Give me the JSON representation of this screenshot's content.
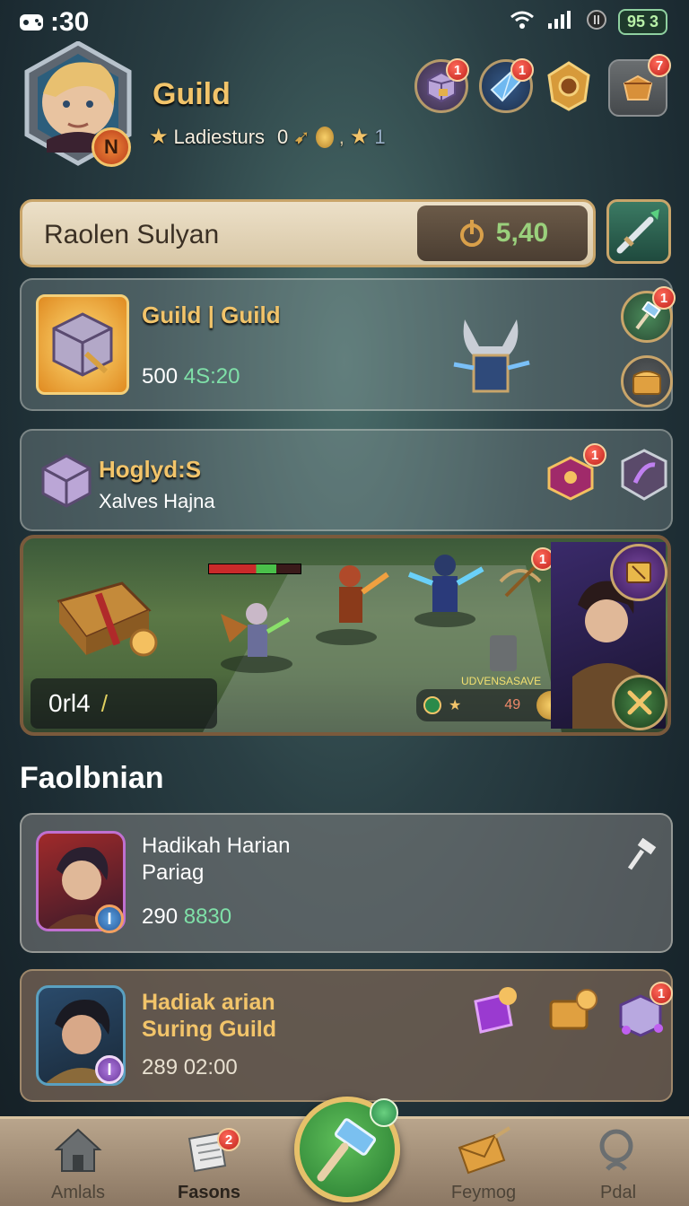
{
  "status": {
    "time": ":30",
    "battery": "95 3"
  },
  "header": {
    "title": "Guild",
    "subtitle": "Ladiesturs",
    "subtitle_value": "0",
    "subtitle_extra": "1",
    "top_icons": [
      {
        "icon": "cube-chest-icon",
        "badge": "1"
      },
      {
        "icon": "crystal-icon",
        "badge": "1"
      },
      {
        "icon": "amulet-icon",
        "badge": ""
      },
      {
        "icon": "gift-box-icon",
        "badge": "7"
      }
    ],
    "avatar_badge": "N"
  },
  "namebar": {
    "label": "Raolen Sulyan",
    "value": "5,40"
  },
  "cards": {
    "card1": {
      "title": "Guild | Guild",
      "num": "500",
      "num_green": "4S:20",
      "badge": "1"
    },
    "card2": {
      "title": "Hoglyd:S",
      "subtitle": "Xalves Hajna",
      "badge": "1"
    },
    "card3": {
      "counter": "0rl4",
      "counter_suffix": "/",
      "hud_label": "UDVENSASAVE",
      "hud_value": "49",
      "badge": "1"
    }
  },
  "section": {
    "title": "Faolbnian"
  },
  "list": [
    {
      "line1": "Hadikah Harian",
      "line2": "Pariag",
      "num": "290",
      "num_green": "8830",
      "style": "plain"
    },
    {
      "line1": "Hadiak arian",
      "line2": "Suring Guild",
      "num": "289 02:00",
      "num_green": "",
      "style": "gold",
      "badge": "1"
    }
  ],
  "nav": {
    "items": [
      {
        "label": "Amlals",
        "icon": "home-icon"
      },
      {
        "label": "Fasons",
        "icon": "scroll-icon",
        "badge": "2"
      },
      {
        "label": "Feymog",
        "icon": "envelope-icon"
      },
      {
        "label": "Pdal",
        "icon": "search-icon"
      }
    ]
  },
  "colors": {
    "gold": "#f2c46a",
    "green": "#7fe0a8",
    "badge": "#c0211b"
  }
}
